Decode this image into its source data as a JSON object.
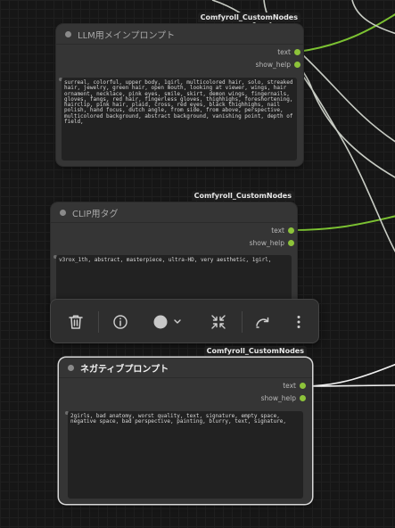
{
  "nodes": [
    {
      "id": "llm-main-prompt",
      "title": "LLM用メインプロンプト",
      "badge": "Comfyroll_CustomNodes",
      "outputs": [
        "text",
        "show_help"
      ],
      "prompt_text": "surreal, colorful, upper body, 1girl, multicolored hair, solo, streaked hair, jewelry, green hair, open mouth, looking at viewer, wings, hair ornament, necklace, pink eyes, smile, skirt, demon wings, fingernails, gloves, fangs, red hair, fingerless gloves, thighhighs, foreshortening, hairclip, pink hair, plaid, cross, red eyes, black thighhighs, nail polish, hand focus, dutch angle, from side, from above, perspective, multicolored background, abstract background, vanishing point, depth of field,"
    },
    {
      "id": "clip-tag",
      "title": "CLIP用タグ",
      "badge": "Comfyroll_CustomNodes",
      "outputs": [
        "text",
        "show_help"
      ],
      "prompt_text": "v3rox_1th, abstract, masterpiece, ultra-HD, very aesthetic, 1girl,"
    },
    {
      "id": "negative-prompt",
      "title": "ネガティブプロンプト",
      "badge": "Comfyroll_CustomNodes",
      "outputs": [
        "text",
        "show_help"
      ],
      "prompt_text": "2girls, bad anatomy, worst quality, text, signature, empty space, negative space, bad perspective, painting, blurry, text, signature,"
    }
  ],
  "toolbar": {
    "buttons": [
      "trash-icon",
      "info-icon",
      "color-picker",
      "collapse-icon",
      "bypass-icon",
      "more-icon"
    ],
    "color_swatch": "#c8c8c8"
  },
  "colors": {
    "canvas": "#161616",
    "node_body": "#353535",
    "text_input": "#222222",
    "string_wire": "#7cc232",
    "link_wire": "#c8ccc4",
    "selected_outline": "#d8d8d8"
  }
}
